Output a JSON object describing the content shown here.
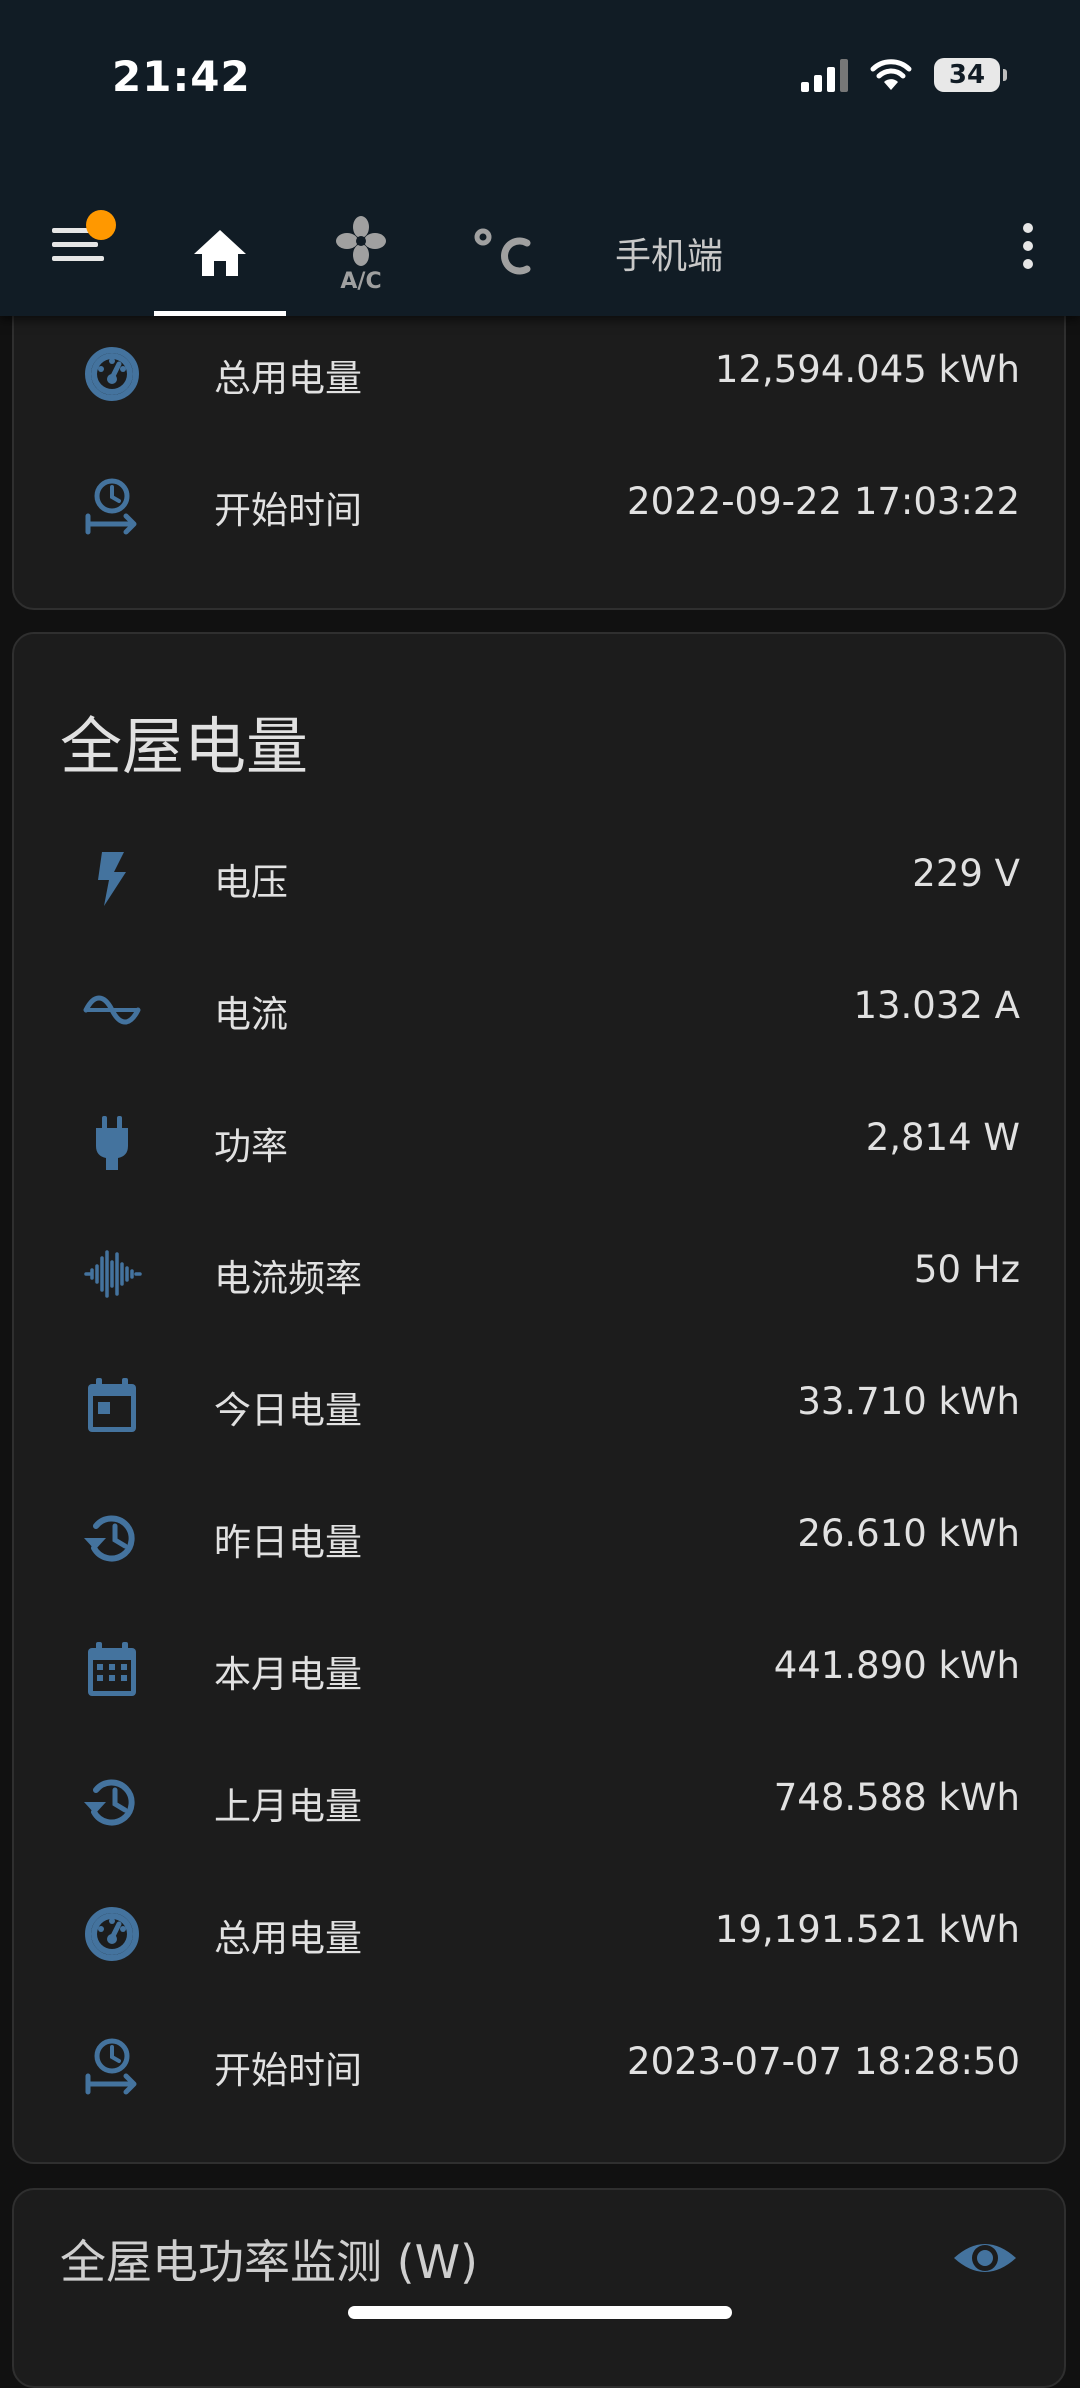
{
  "status_bar": {
    "time": "21:42",
    "battery": "34"
  },
  "header": {
    "tabs": [
      {
        "kind": "home-icon"
      },
      {
        "kind": "ac-icon"
      },
      {
        "kind": "thermometer-celsius-icon"
      },
      {
        "label": "手机端"
      }
    ]
  },
  "card_top": {
    "rows": [
      {
        "icon": "gauge-icon",
        "label": "总用电量",
        "value": "12,594.045 kWh"
      },
      {
        "icon": "clock-start-icon",
        "label": "开始时间",
        "value": "2022-09-22 17:03:22"
      }
    ]
  },
  "card_main": {
    "title": "全屋电量",
    "rows": [
      {
        "icon": "flash-icon",
        "label": "电压",
        "value": "229 V"
      },
      {
        "icon": "sine-wave-icon",
        "label": "电流",
        "value": "13.032 A"
      },
      {
        "icon": "plug-icon",
        "label": "功率",
        "value": "2,814 W"
      },
      {
        "icon": "waveform-icon",
        "label": "电流频率",
        "value": "50 Hz"
      },
      {
        "icon": "calendar-today-icon",
        "label": "今日电量",
        "value": "33.710 kWh"
      },
      {
        "icon": "history-icon",
        "label": "昨日电量",
        "value": "26.610 kWh"
      },
      {
        "icon": "calendar-month-icon",
        "label": "本月电量",
        "value": "441.890 kWh"
      },
      {
        "icon": "history-icon",
        "label": "上月电量",
        "value": "748.588 kWh"
      },
      {
        "icon": "gauge-icon",
        "label": "总用电量",
        "value": "19,191.521 kWh"
      },
      {
        "icon": "clock-start-icon",
        "label": "开始时间",
        "value": "2023-07-07 18:28:50"
      }
    ]
  },
  "card_chart": {
    "title": "全屋电功率监测 (W)"
  },
  "colors": {
    "icon": "#44739e",
    "badge": "#ff9800",
    "header_bg": "#111c25",
    "card_bg": "#1c1c1c"
  }
}
